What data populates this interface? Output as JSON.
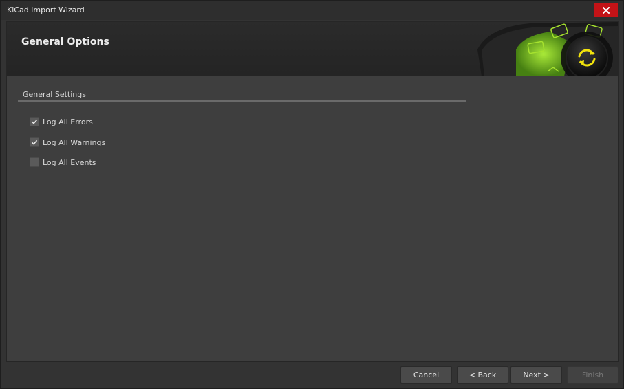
{
  "window": {
    "title": "KiCad Import Wizard"
  },
  "header": {
    "title": "General Options"
  },
  "general_settings": {
    "title": "General Settings",
    "options": [
      {
        "label": "Log All Errors",
        "checked": true
      },
      {
        "label": "Log All Warnings",
        "checked": true
      },
      {
        "label": "Log All Events",
        "checked": false
      }
    ]
  },
  "footer": {
    "cancel_label": "Cancel",
    "back_label": "< Back",
    "next_label": "Next >",
    "finish_label": "Finish"
  },
  "colors": {
    "close_button": "#c31317",
    "accent_green": "#9be02a",
    "accent_yellow": "#f2e30c"
  }
}
